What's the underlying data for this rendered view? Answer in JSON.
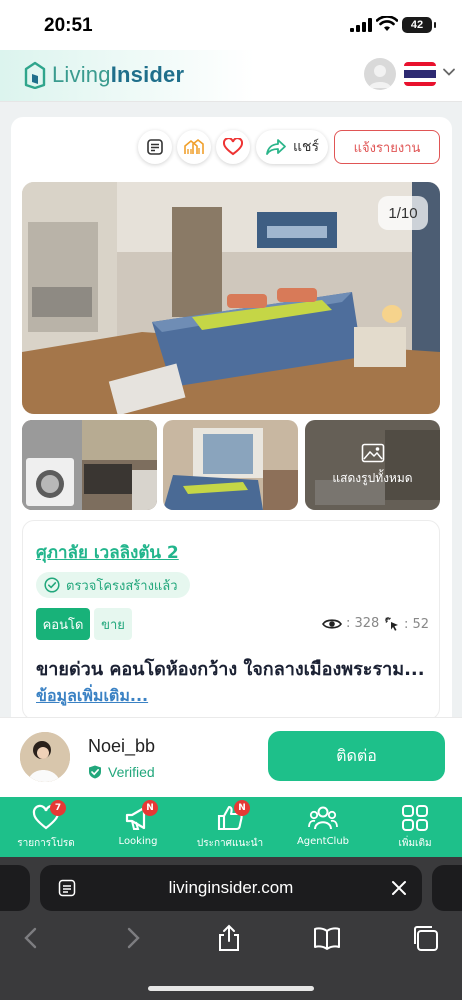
{
  "status_bar": {
    "time": "20:51",
    "battery": "42"
  },
  "header": {
    "logo_part1": "Living",
    "logo_part2": "Insider"
  },
  "actions": {
    "share_label": "แชร์",
    "report_label": "แจ้งรายงาน"
  },
  "gallery": {
    "counter": "1/10",
    "show_all_label": "แสดงรูปทั้งหมด"
  },
  "listing": {
    "project_name": "ศุภาลัย เวลลิงตัน 2",
    "structure_verified": "ตรวจโครงสร้างแล้ว",
    "tag_type": "คอนโด",
    "tag_deal": "ขาย",
    "views": ": 328",
    "clicks": ": 52",
    "title": "ขายด่วน คอนโดห้องกว้าง ใจกลางเมืองพระราม...",
    "more_link": "ข้อมูลเพิ่มเติม..."
  },
  "agent": {
    "name": "Noei_bb",
    "verified": "Verified",
    "contact_label": "ติดต่อ"
  },
  "bottom_nav": [
    {
      "label": "รายการโปรด",
      "badge": "7",
      "icon": "heart-icon"
    },
    {
      "label": "Looking",
      "badge": "N",
      "icon": "megaphone-icon"
    },
    {
      "label": "ประกาศแนะนำ",
      "badge": "N",
      "icon": "thumbs-up-icon"
    },
    {
      "label": "AgentClub",
      "badge": "",
      "icon": "group-icon"
    },
    {
      "label": "เพิ่มเติม",
      "badge": "",
      "icon": "grid-icon"
    }
  ],
  "browser": {
    "url": "livinginsider.com"
  },
  "colors": {
    "brand_green": "#1ec08a",
    "report_red": "#e05555",
    "link_blue": "#3b82c4"
  }
}
